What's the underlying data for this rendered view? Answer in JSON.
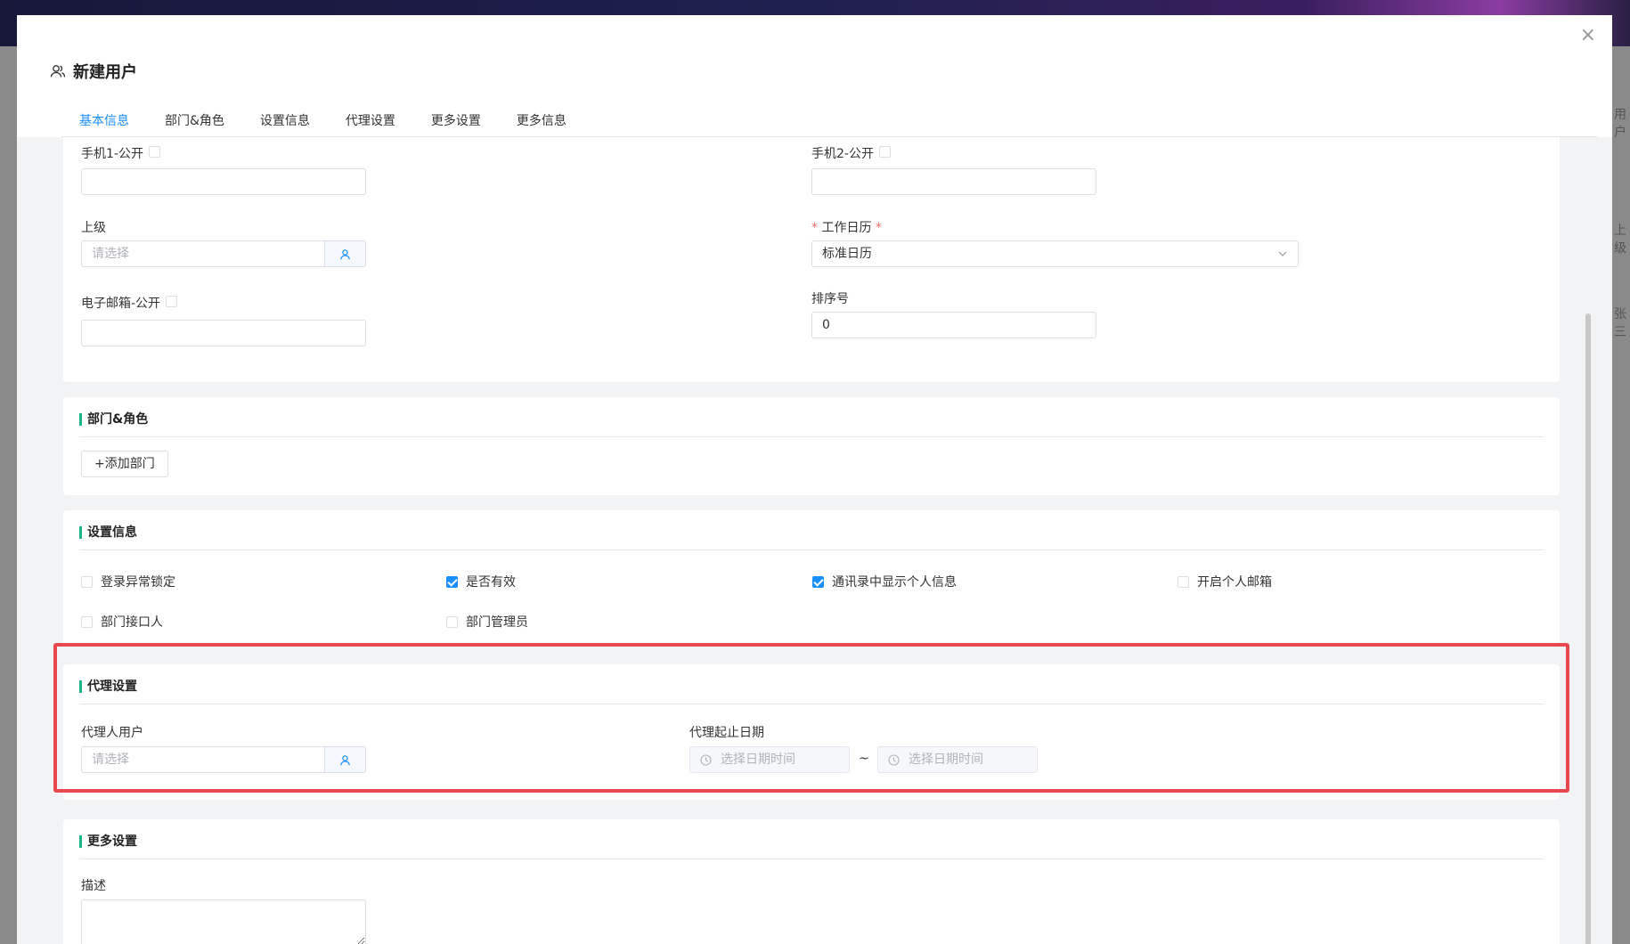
{
  "background": {
    "edge_texts": [
      "用户",
      "上级",
      "张三"
    ]
  },
  "dialog": {
    "title": "新建用户",
    "close_label": "×",
    "tabs": [
      "基本信息",
      "部门&角色",
      "设置信息",
      "代理设置",
      "更多设置",
      "更多信息"
    ],
    "active_tab": "基本信息"
  },
  "basic": {
    "phone1_label": "手机1-公开",
    "phone1_value": "",
    "phone2_label": "手机2-公开",
    "phone2_value": "",
    "superior_label": "上级",
    "superior_placeholder": "请选择",
    "calendar_label": "工作日历",
    "calendar_value": "标准日历",
    "email_label": "电子邮箱-公开",
    "email_value": "",
    "order_label": "排序号",
    "order_value": "0"
  },
  "dept_role": {
    "heading": "部门&角色",
    "add_dept_label": "+添加部门"
  },
  "settings": {
    "heading": "设置信息",
    "options": [
      {
        "label": "登录异常锁定",
        "checked": false
      },
      {
        "label": "是否有效",
        "checked": true
      },
      {
        "label": "通讯录中显示个人信息",
        "checked": true
      },
      {
        "label": "开启个人邮箱",
        "checked": false
      },
      {
        "label": "部门接口人",
        "checked": false
      },
      {
        "label": "部门管理员",
        "checked": false
      }
    ]
  },
  "proxy": {
    "heading": "代理设置",
    "user_label": "代理人用户",
    "user_placeholder": "请选择",
    "date_label": "代理起止日期",
    "start_placeholder": "选择日期时间",
    "separator": "~",
    "end_placeholder": "选择日期时间"
  },
  "more": {
    "heading": "更多设置",
    "desc_label": "描述",
    "desc_value": ""
  },
  "colors": {
    "accent": "#1a90ff",
    "section_bar": "#19b38a",
    "highlight": "#e8474e"
  }
}
